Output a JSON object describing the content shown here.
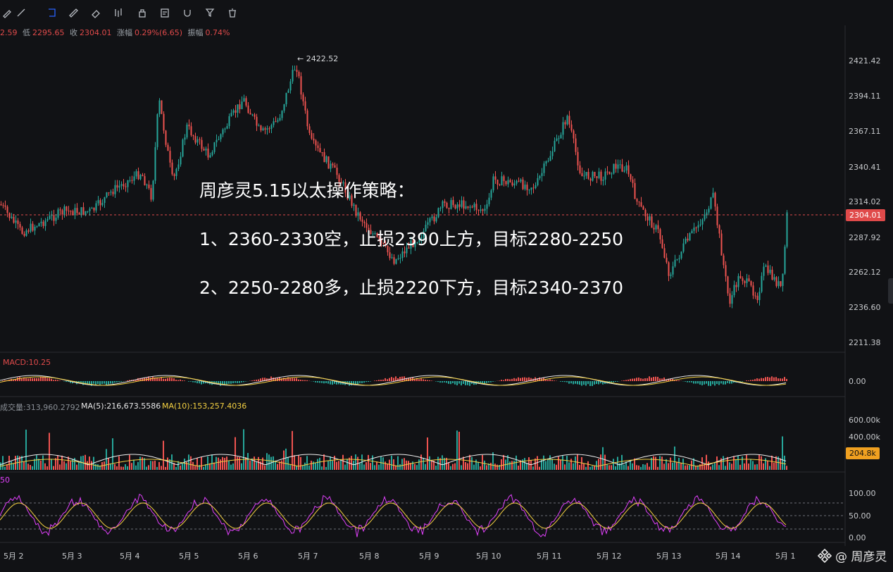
{
  "toolbar": {
    "icons": [
      "pen-icon",
      "brush-icon",
      "path-icon",
      "ruler-icon",
      "eraser-icon",
      "candlestick-icon",
      "lock-icon",
      "notes-icon",
      "magnet-icon",
      "filter-icon",
      "trash-icon"
    ]
  },
  "ohlc": {
    "high_part": "2.59",
    "low_label": "低",
    "low": "2295.65",
    "close_label": "收",
    "close": "2304.01",
    "change_label": "涨幅",
    "change": "0.29%(6.65)",
    "range_label": "振幅",
    "range": "0.74%"
  },
  "price_axis": [
    "2421.42",
    "2394.11",
    "2367.11",
    "2340.41",
    "2314.02",
    "2287.92",
    "2262.12",
    "2236.60",
    "2211.38"
  ],
  "last_price": "2304.01",
  "peak_label": "← 2422.52",
  "overlay": {
    "title": "周彦灵5.15以太操作策略：",
    "line1": "1、2360-2330空，止损2390上方，目标2280-2250",
    "line2": "2、2250-2280多，止损2220下方，目标2340-2370"
  },
  "macd": {
    "label": "MACD:10.25",
    "zero": "0.00"
  },
  "volume": {
    "label": "成交量:313,960.2792",
    "ma5": "MA(5):216,673.5586",
    "ma10": "MA(10):153,257.4036",
    "axis": [
      "600.00k",
      "400.00k"
    ],
    "badge": "204.8k"
  },
  "rsi": {
    "label": "50",
    "axis": [
      "100.00",
      "50.00",
      "0.00"
    ]
  },
  "dates": [
    "5月 2",
    "5月 3",
    "5月 4",
    "5月 5",
    "5月 6",
    "5月 7",
    "5月 8",
    "5月 9",
    "5月 10",
    "5月 11",
    "5月 12",
    "5月 13",
    "5月 14",
    "5月 1"
  ],
  "watermark": "@ 周彦灵",
  "colors": {
    "up": "#26a69a",
    "down": "#ef5350",
    "accent": "#2962ff",
    "macd": "#e8e8e8",
    "ma5": "#f0f0f0",
    "ma10": "#f5d142",
    "rsi1": "#e040fb",
    "rsi2": "#f5d142"
  }
}
